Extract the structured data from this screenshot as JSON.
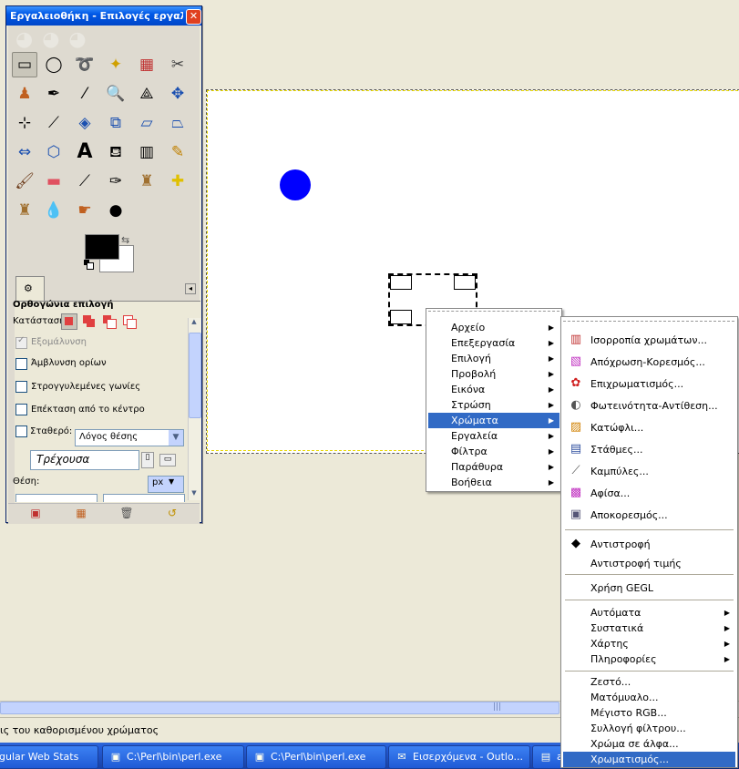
{
  "toolbox": {
    "title": "Εργαλειοθήκη - Επιλογές εργαλεί...",
    "close": "✕",
    "options_title": "Ορθογώνια επιλογή",
    "mode_label": "Κατάσταση:",
    "antialias": "Εξομάλυνση",
    "feather": "Άμβλυνση ορίων",
    "rounded": "Στρογγυλεμένες γωνίες",
    "expand": "Επέκταση από το κέντρο",
    "fixed_label": "Σταθερό:",
    "fixed_value": "Λόγος θέσης",
    "current": "Τρέχουσα",
    "position_label": "Θέση:",
    "unit": "px"
  },
  "status_text": "ις του καθορισμένου χρώματος",
  "taskbar": [
    {
      "label": "gular Web Stats"
    },
    {
      "label": "C:\\Perl\\bin\\perl.exe"
    },
    {
      "label": "C:\\Perl\\bin\\perl.exe"
    },
    {
      "label": "Εισερχόμενα - Outlo..."
    },
    {
      "label": "al"
    }
  ],
  "menu": {
    "items": [
      {
        "label": "Αρχείο"
      },
      {
        "label": "Επεξεργασία"
      },
      {
        "label": "Επιλογή"
      },
      {
        "label": "Προβολή"
      },
      {
        "label": "Εικόνα"
      },
      {
        "label": "Στρώση"
      },
      {
        "label": "Χρώματα"
      },
      {
        "label": "Εργαλεία"
      },
      {
        "label": "Φίλτρα"
      },
      {
        "label": "Παράθυρα"
      },
      {
        "label": "Βοήθεια"
      }
    ]
  },
  "colors_menu": {
    "items": [
      {
        "label": "Ισορροπία χρωμάτων..."
      },
      {
        "label": "Απόχρωση-Κορεσμός..."
      },
      {
        "label": "Επιχρωματισμός..."
      },
      {
        "label": "Φωτεινότητα-Αντίθεση..."
      },
      {
        "label": "Κατώφλι..."
      },
      {
        "label": "Στάθμες..."
      },
      {
        "label": "Καμπύλες..."
      },
      {
        "label": "Αφίσα..."
      },
      {
        "label": "Αποκορεσμός..."
      },
      {
        "label": "Αντιστροφή"
      },
      {
        "label": "Αντιστροφή τιμής"
      },
      {
        "label": "Χρήση GEGL"
      },
      {
        "label": "Αυτόματα"
      },
      {
        "label": "Συστατικά"
      },
      {
        "label": "Χάρτης"
      },
      {
        "label": "Πληροφορίες"
      },
      {
        "label": "Ζεστό..."
      },
      {
        "label": "Ματόμυαλο..."
      },
      {
        "label": "Μέγιστο RGB..."
      },
      {
        "label": "Συλλογή φίλτρου..."
      },
      {
        "label": "Χρώμα σε άλφα..."
      },
      {
        "label": "Χρωματισμός..."
      }
    ]
  },
  "colors": {
    "accent": "#316ac5",
    "dot": "#0000ff",
    "title_bar": "#0058e6"
  }
}
